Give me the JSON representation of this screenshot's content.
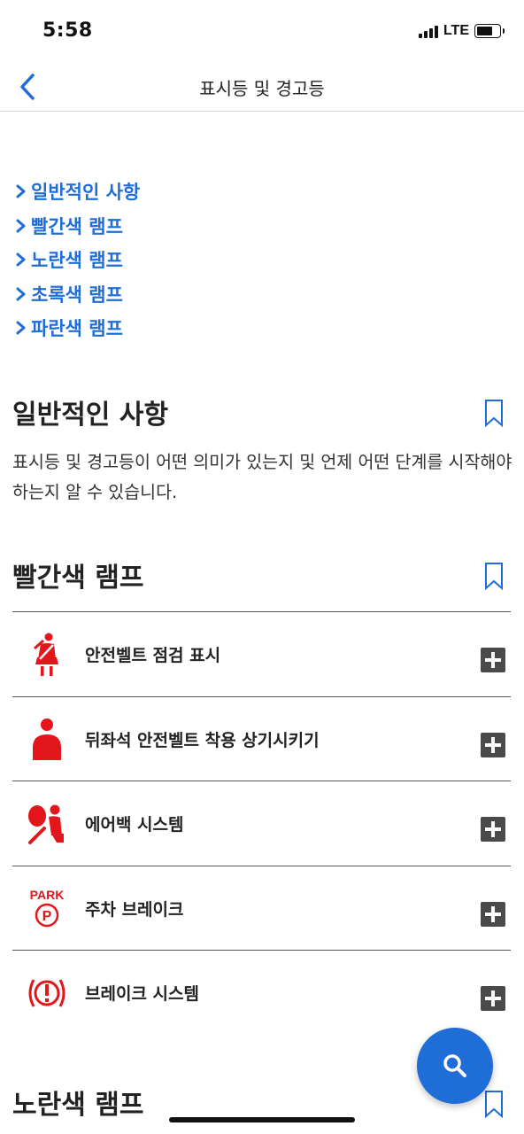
{
  "status": {
    "time": "5:58",
    "network": "LTE"
  },
  "nav": {
    "title": "표시등 및 경고등"
  },
  "toc": [
    "일반적인 사항",
    "빨간색 램프",
    "노란색 램프",
    "초록색 램프",
    "파란색 램프"
  ],
  "general": {
    "title": "일반적인 사항",
    "body": "표시등 및 경고등이 어떤 의미가 있는지 및 언제 어떤 단계를 시작해야 하는지 알 수 있습니다."
  },
  "red": {
    "title": "빨간색 램프",
    "items": [
      {
        "label": "안전벨트 점검 표시",
        "icon": "seatbelt-icon"
      },
      {
        "label": "뒤좌석 안전벨트 착용 상기시키기",
        "icon": "rear-seat-person-icon"
      },
      {
        "label": "에어백 시스템",
        "icon": "airbag-icon"
      },
      {
        "label": "주차 브레이크",
        "icon": "park-brake-icon",
        "icon_text": "PARK"
      },
      {
        "label": "브레이크 시스템",
        "icon": "brake-system-icon"
      }
    ]
  },
  "yellow": {
    "title": "노란색 램프"
  },
  "colors": {
    "accent": "#1f6dd6",
    "warning_red": "#e3161b",
    "expand_gray": "#4a4a4a"
  }
}
